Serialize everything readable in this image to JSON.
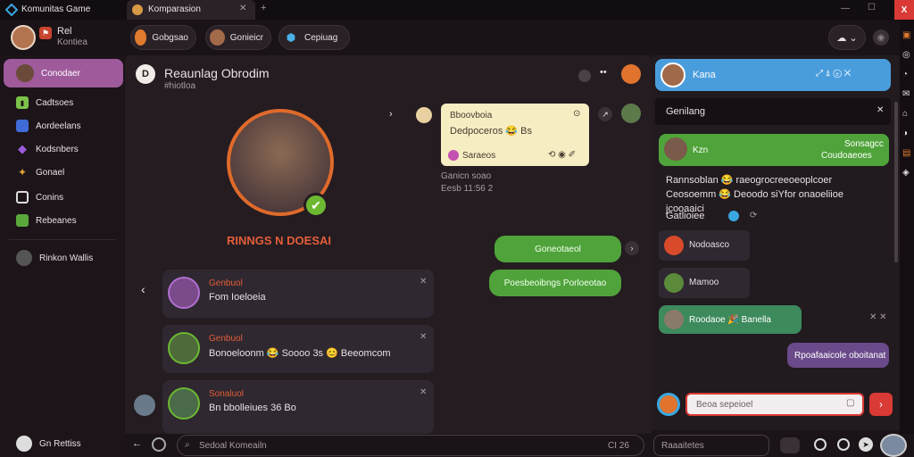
{
  "window": {
    "app_title": "Komunitas Game",
    "tab_title": "Komparasion",
    "close_label": "X"
  },
  "header": {
    "user_name": "Rel",
    "user_sub": "Kontiea",
    "pills": [
      "Gobgsao",
      "Gonieicr",
      "Cepiuag"
    ]
  },
  "sidebar": {
    "items": [
      {
        "label": "Conodaer",
        "icon": "avatar-icon",
        "active": true
      },
      {
        "label": "Cadtsoes",
        "icon": "chart-icon"
      },
      {
        "label": "Aordeelans",
        "icon": "shield-icon"
      },
      {
        "label": "Kodsnbers",
        "icon": "gem-icon"
      },
      {
        "label": "Gonael",
        "icon": "trophy-icon"
      },
      {
        "label": "Conins",
        "icon": "doc-icon"
      },
      {
        "label": "Rebeanes",
        "icon": "picture-icon"
      }
    ],
    "extra": "Rinkon Wallis",
    "footer": "Gn Rettiss"
  },
  "main": {
    "title": "Reaunlag Obrodim",
    "subtitle": "#hiotloa",
    "hero_name": "RINNGS N DOESAI",
    "note_card": {
      "line1": "Bboovboia",
      "line2": "Dedpoceros 😂 Bs",
      "reaction": "Saraeos"
    },
    "note_meta": [
      "Ganicn soao",
      "Eesb 11:56 2"
    ],
    "green_bubble_1": "Goneotaeol",
    "green_bubble_2": "Poesbeoibngs Porloeotao",
    "feed": [
      {
        "name": "Genbuol",
        "text": "Fom Ioeloeia"
      },
      {
        "name": "Genbuol",
        "text": "Bonoeloonm 😂 Soooo 3s 😊 Beeomcom"
      },
      {
        "name": "Sonaluol",
        "text": "Bn bbolleiues 36 Bo"
      }
    ],
    "search_placeholder": "Sedoal Komeailn",
    "search_hint": "CI 26",
    "second_input": "Raaaitetes"
  },
  "right": {
    "header_name": "Kana",
    "panel_title": "Genilang",
    "entry1": {
      "name": "Kzn",
      "meta1": "Sonsagcc",
      "meta2": "Coudoaeoes"
    },
    "body_text": "Rannsoblan 😂 raeogrocreeoeoplcoer Ceosoemm 😂 Deoodo siYfor onaoeliioe jcooaaici",
    "badge_text": "Gatlioiee",
    "list": [
      "Nodoasco",
      "Mamoo"
    ],
    "green_reply": "Roodaoe 🎉 Banella",
    "purple_reply": "Rpoafaaicole oboitanat",
    "input_placeholder": "Beoa sepeioel"
  },
  "colors": {
    "accent_purple": "#9e5a9b",
    "accent_green": "#4fa33a",
    "accent_blue": "#4a9ddc",
    "accent_red": "#d93a35"
  }
}
